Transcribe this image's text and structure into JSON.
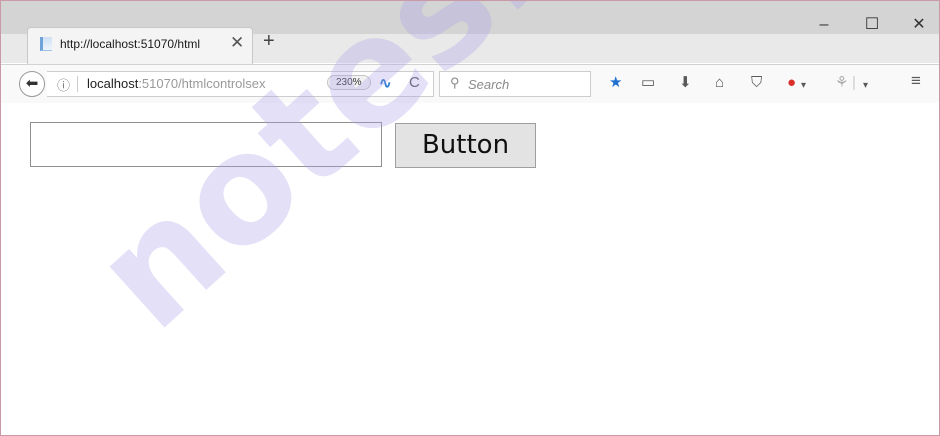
{
  "tab": {
    "title": "http://localhost:51070/html"
  },
  "window_controls": {
    "minimize": "–",
    "maximize": "☐",
    "close": "✕"
  },
  "navbar": {
    "url_host": "localhost",
    "url_path": ":51070/htmlcontrolsex",
    "zoom": "230%",
    "search_placeholder": "Search"
  },
  "page": {
    "textbox_value": "",
    "button_label": "Button"
  },
  "watermark": "notes.in",
  "colors": {
    "accent_blue": "#2b7bd6",
    "star": "#1f6fd0",
    "abp_red": "#d9302c"
  }
}
